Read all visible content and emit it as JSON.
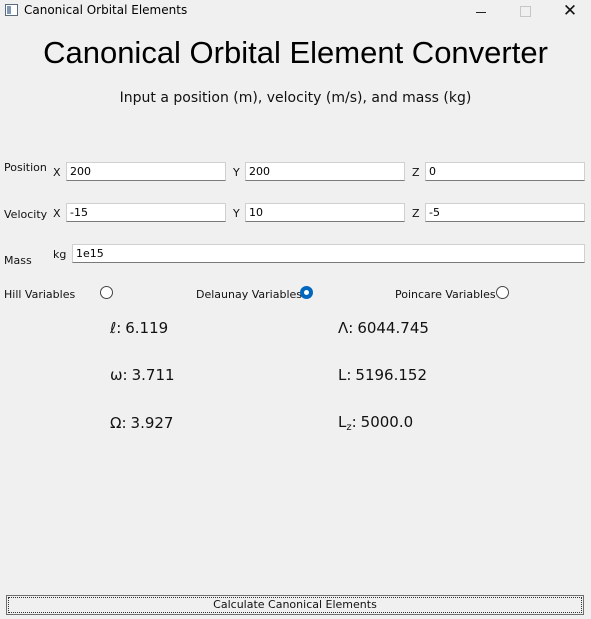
{
  "window": {
    "title": "Canonical Orbital Elements",
    "minimize_glyph": "—",
    "close_glyph": "✕"
  },
  "header": {
    "title": "Canonical Orbital Element Converter",
    "subtitle": "Input a position (m), velocity (m/s), and mass (kg)"
  },
  "position": {
    "label": "Position",
    "x_label": "X",
    "x_value": "200",
    "y_label": "Y",
    "y_value": "200",
    "z_label": "Z",
    "z_value": "0"
  },
  "velocity": {
    "label": "Velocity",
    "x_label": "X",
    "x_value": "-15",
    "y_label": "Y",
    "y_value": "10",
    "z_label": "Z",
    "z_value": "-5"
  },
  "mass": {
    "label": "Mass",
    "unit_label": "kg",
    "value": "1e15"
  },
  "variable_sets": {
    "options": [
      "Hill Variables",
      "Delaunay Variables",
      "Poincare Variables"
    ],
    "selected": "Delaunay Variables"
  },
  "results": {
    "left": [
      {
        "name": "ℓ:",
        "value": "6.119"
      },
      {
        "name": "ω:",
        "value": "3.711"
      },
      {
        "name": "Ω:",
        "value": "3.927"
      }
    ],
    "right": [
      {
        "name": "Λ:",
        "value": "6044.745"
      },
      {
        "name": "L:",
        "value": "5196.152"
      },
      {
        "name_base": "L",
        "name_sub": "z",
        "name_suffix": ":",
        "value": "5000.0"
      }
    ]
  },
  "actions": {
    "calculate_label": "Calculate Canonical Elements"
  },
  "colors": {
    "background": "#f0f0f0",
    "accent": "#0067c0"
  }
}
